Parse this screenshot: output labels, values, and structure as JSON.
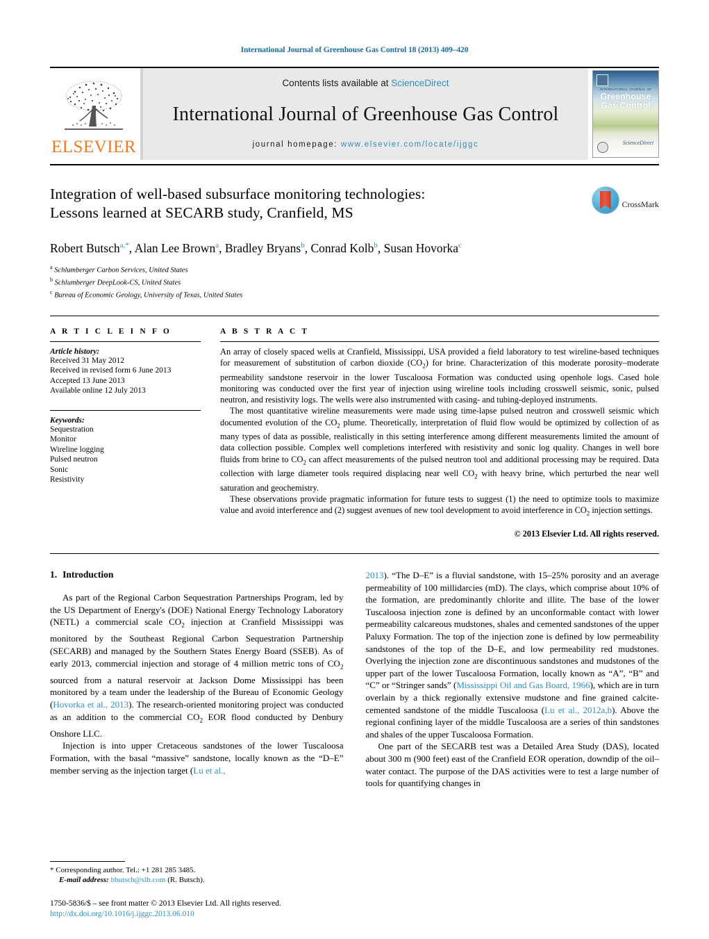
{
  "running_head": "International Journal of Greenhouse Gas Control 18 (2013) 409–420",
  "masthead": {
    "publisher_name": "ELSEVIER",
    "contents_prefix": "Contents lists available at ",
    "contents_link": "ScienceDirect",
    "journal_name": "International Journal of Greenhouse Gas Control",
    "homepage_prefix": "journal homepage: ",
    "homepage_url": "www.elsevier.com/locate/ijggc",
    "cover": {
      "superline": "INTERNATIONAL JOURNAL OF",
      "title_line1": "Greenhouse",
      "title_line2": "Gas Control",
      "publisher_mark": "ScienceDirect"
    }
  },
  "article": {
    "title_line1": "Integration of well-based subsurface monitoring technologies:",
    "title_line2": "Lessons learned at SECARB study, Cranfield, MS",
    "crossmark_label": "CrossMark",
    "authors": [
      {
        "name": "Robert Butsch",
        "marks": "a,*",
        "sep": ", "
      },
      {
        "name": "Alan Lee Brown",
        "marks": "a",
        "sep": ", "
      },
      {
        "name": "Bradley Bryans",
        "marks": "b",
        "sep": ", "
      },
      {
        "name": "Conrad Kolb",
        "marks": "b",
        "sep": ", "
      },
      {
        "name": "Susan Hovorka",
        "marks": "c",
        "sep": ""
      }
    ],
    "affiliations": [
      {
        "mark": "a",
        "text": "Schlumberger Carbon Services, United States"
      },
      {
        "mark": "b",
        "text": "Schlumberger DeepLook-CS, United States"
      },
      {
        "mark": "c",
        "text": "Bureau of Economic Geology, University of Texas, United States"
      }
    ]
  },
  "article_info": {
    "heading": "A R T I C L E   I N F O",
    "history_label": "Article history:",
    "history": [
      "Received 31 May 2012",
      "Received in revised form 6 June 2013",
      "Accepted 13 June 2013",
      "Available online 12 July 2013"
    ],
    "keywords_label": "Keywords:",
    "keywords": [
      "Sequestration",
      "Monitor",
      "Wireline logging",
      "Pulsed neutron",
      "Sonic",
      "Resistivity"
    ]
  },
  "abstract": {
    "heading": "A B S T R A C T",
    "paragraph1_a": "An array of closely spaced wells at Cranfield, Mississippi, USA provided a field laboratory to test wireline-based techniques for measurement of substitution of carbon dioxide (CO",
    "paragraph1_b": ") for brine. Characterization of this moderate porosity–moderate permeability sandstone reservoir in the lower Tuscaloosa Formation was conducted using openhole logs. Cased hole monitoring was conducted over the first year of injection using wireline tools including crosswell seismic, sonic, pulsed neutron, and resistivity logs. The wells were also instrumented with casing- and tubing-deployed instruments.",
    "paragraph2_a": "The most quantitative wireline measurements were made using time-lapse pulsed neutron and crosswell seismic which documented evolution of the CO",
    "paragraph2_b": " plume. Theoretically, interpretation of fluid flow would be optimized by collection of as many types of data as possible, realistically in this setting interference among different measurements limited the amount of data collection possible. Complex well completions interfered with resistivity and sonic log quality. Changes in well bore fluids from brine to CO",
    "paragraph2_c": " can affect measurements of the pulsed neutron tool and additional processing may be required. Data collection with large diameter tools required displacing near well CO",
    "paragraph2_d": " with heavy brine, which perturbed the near well saturation and geochemistry.",
    "paragraph3_a": "These observations provide pragmatic information for future tests to suggest (1) the need to optimize tools to maximize value and avoid interference and (2) suggest avenues of new tool development to avoid interference in CO",
    "paragraph3_b": " injection settings.",
    "copyright": "© 2013 Elsevier Ltd. All rights reserved."
  },
  "body": {
    "section_number": "1.",
    "section_title": "Introduction",
    "left_p1_a": "As part of the Regional Carbon Sequestration Partnerships Program, led by the US Department of Energy's (DOE) National Energy Technology Laboratory (NETL) a commercial scale CO",
    "left_p1_b": " injection at Cranfield Mississippi was monitored by the Southeast Regional Carbon Sequestration Partnership (SECARB) and managed by the Southern States Energy Board (SSEB). As of early 2013, commercial injection and storage of 4 million metric tons of CO",
    "left_p1_c": " sourced from a natural reservoir at Jackson Dome Mississippi has been monitored by a team under the leadership of the Bureau of Economic Geology (",
    "left_p1_ref": "Hovorka et al., 2013",
    "left_p1_d": "). The research-oriented monitoring project was conducted as an addition to the commercial CO",
    "left_p1_e": " EOR flood conducted by Denbury Onshore LLC.",
    "left_p2_a": "Injection is into upper Cretaceous sandstones of the lower Tuscaloosa Formation, with the basal “massive” sandstone, locally known as the “D–E” member serving as the injection target (",
    "left_p2_ref": "Lu et al.,",
    "right_p1_ref_cont": "2013",
    "right_p1_a": "). “The D–E” is a fluvial sandstone, with 15–25% porosity and an average permeability of 100 millidarcies (mD). The clays, which comprise about 10% of the formation, are predominantly chlorite and illite. The base of the lower Tuscaloosa injection zone is defined by an unconformable contact with lower permeability calcareous mudstones, shales and cemented sandstones of the upper Paluxy Formation. The top of the injection zone is defined by low permeability sandstones of the top of the D–E, and low permeability red mudstones. Overlying the injection zone are discontinuous sandstones and mudstones of the upper part of the lower Tuscaloosa Formation, locally known as “A”, “B” and “C” or “Stringer sands” (",
    "right_p1_ref2": "Mississippi Oil and Gas Board, 1966",
    "right_p1_b": "), which are in turn overlain by a thick regionally extensive mudstone and fine grained calcite-cemented sandstone of the middle Tuscaloosa (",
    "right_p1_ref3": "Lu et al., 2012a,b",
    "right_p1_c": "). Above the regional confining layer of the middle Tuscaloosa are a series of thin sandstones and shales of the upper Tuscaloosa Formation.",
    "right_p2": "One part of the SECARB test was a Detailed Area Study (DAS), located about 300 m (900 feet) east of the Cranfield EOR operation, downdip of the oil–water contact. The purpose of the DAS activities were to test a large number of tools for quantifying changes in"
  },
  "footnote": {
    "star": "*",
    "corresponding": "Corresponding author. Tel.: +1 281 285 3485.",
    "email_label": "E-mail address:",
    "email": "bbutsch@slb.com",
    "email_suffix": "(R. Butsch)."
  },
  "footer": {
    "issn_line": "1750-5836/$ – see front matter © 2013 Elsevier Ltd. All rights reserved.",
    "doi": "http://dx.doi.org/10.1016/j.ijggc.2013.06.010"
  },
  "colors": {
    "link": "#2e8ec4",
    "elsevier_orange": "#F47920",
    "runhead": "#1a6e9e"
  }
}
